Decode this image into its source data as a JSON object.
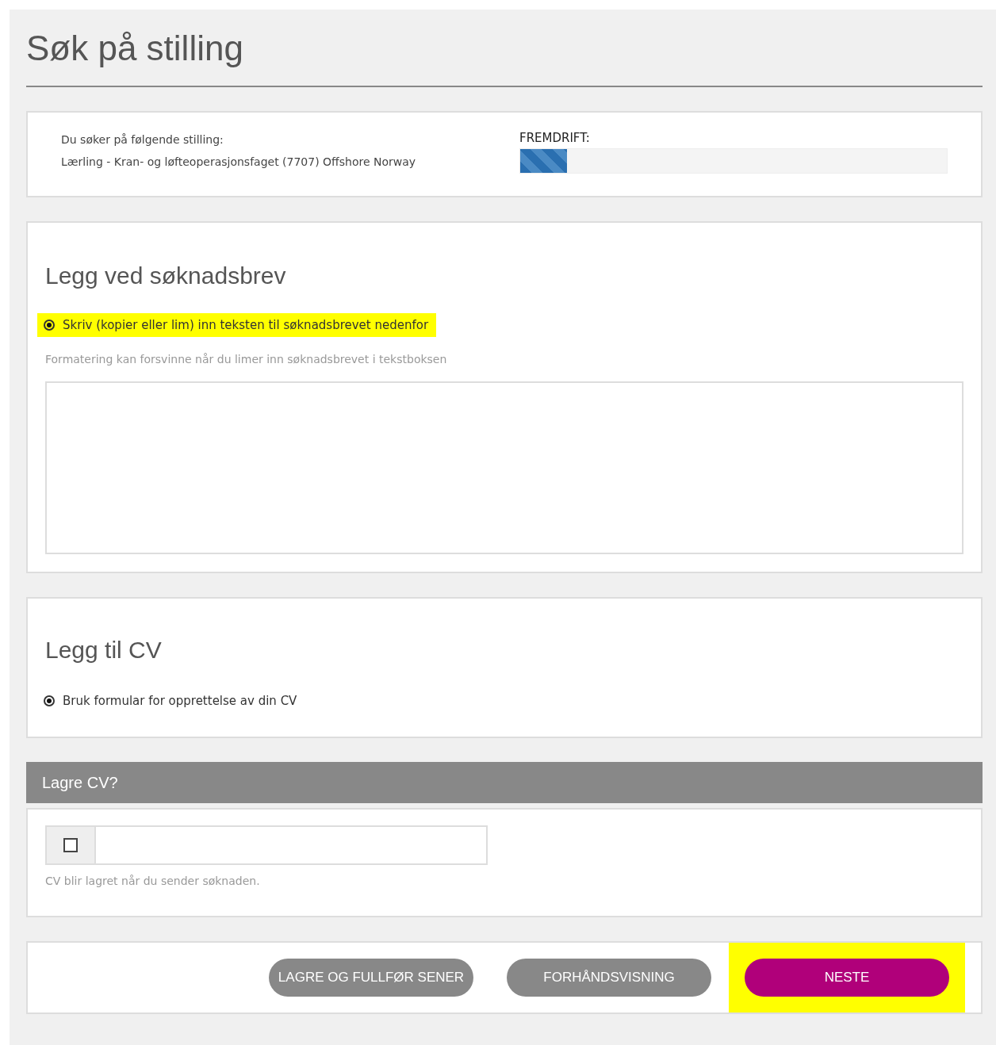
{
  "page": {
    "title": "Søk på stilling"
  },
  "position": {
    "label": "Du søker på følgende stilling:",
    "name": "Lærling - Kran- og løfteoperasjonsfaget (7707) Offshore Norway"
  },
  "progress": {
    "label": "FREMDRIFT:",
    "level": 0.11
  },
  "cover_letter": {
    "heading": "Legg ved søknadsbrev",
    "options": [
      {
        "label": "Skriv (kopier eller lim) inn teksten til søknadsbrevet nedenfor",
        "selected": true,
        "highlighted": true
      }
    ],
    "hint": "Formatering kan forsvinne når du limer inn søknadsbrevet i tekstboksen"
  },
  "cv": {
    "heading": "Legg til CV",
    "options": [
      {
        "label": "Bruk formular for opprettelse av din CV",
        "selected": true,
        "highlighted": false
      }
    ]
  },
  "save_cv": {
    "header": "Lagre CV?",
    "checked": false,
    "note": "CV blir lagret når du sender søknaden."
  },
  "buttons": [
    {
      "label": "LAGRE OG FULLFØR SENER",
      "kind": "secondary",
      "highlighted": false
    },
    {
      "label": "FORHÅNDSVISNING",
      "kind": "secondary",
      "highlighted": false
    },
    {
      "label": "NESTE",
      "kind": "primary",
      "highlighted": true
    }
  ]
}
